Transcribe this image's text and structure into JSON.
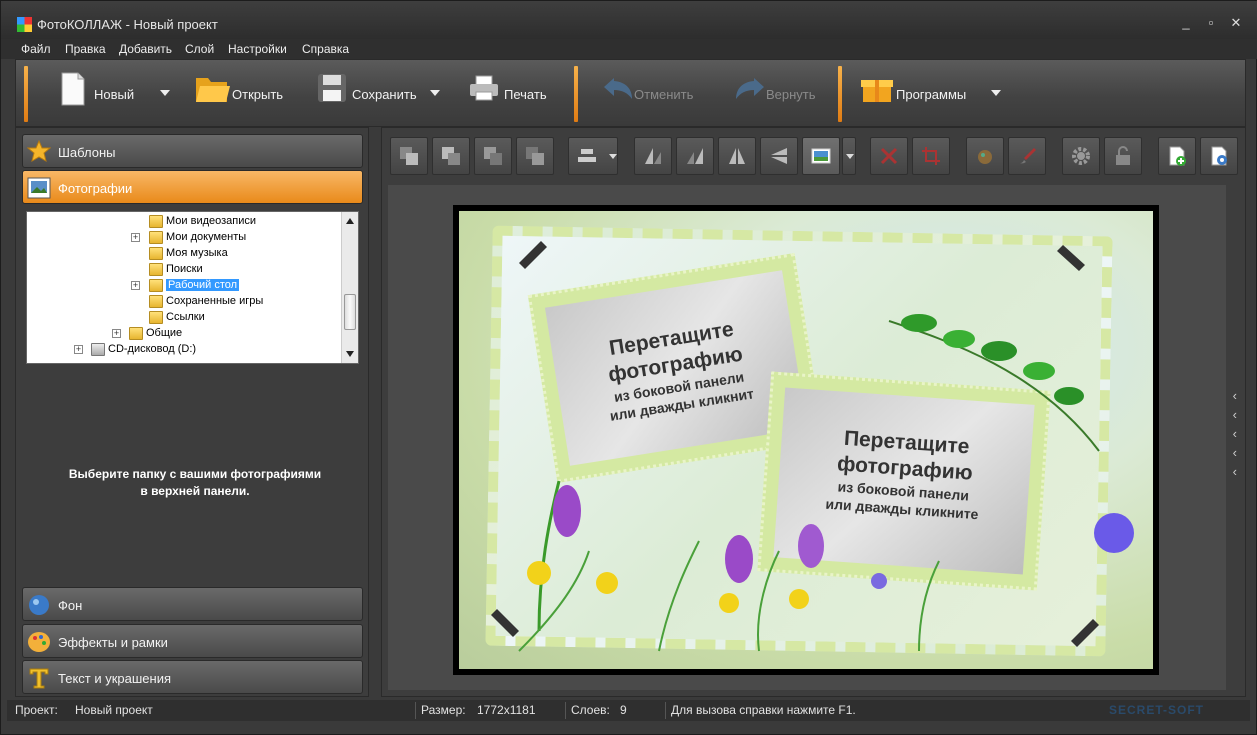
{
  "window": {
    "title": "ФотоКОЛЛАЖ - Новый проект",
    "min": "_",
    "max": "▫",
    "close": "✕"
  },
  "menu": [
    "Файл",
    "Правка",
    "Добавить",
    "Слой",
    "Настройки",
    "Справка"
  ],
  "toolbar": {
    "new": "Новый",
    "open": "Открыть",
    "save": "Сохранить",
    "print": "Печать",
    "undo": "Отменить",
    "redo": "Вернуть",
    "programs": "Программы"
  },
  "left": {
    "templates": "Шаблоны",
    "photos": "Фотографии",
    "tree": [
      {
        "label": "Мои видеозаписи",
        "plus": false
      },
      {
        "label": "Мои документы",
        "plus": true
      },
      {
        "label": "Моя музыка",
        "plus": false
      },
      {
        "label": "Поиски",
        "plus": false
      },
      {
        "label": "Рабочий стол",
        "plus": true,
        "selected": true
      },
      {
        "label": "Сохраненные игры",
        "plus": false
      },
      {
        "label": "Ссылки",
        "plus": false
      },
      {
        "label": "Общие",
        "plus": true
      },
      {
        "label": "CD-дисковод (D:)",
        "plus": true
      }
    ],
    "hint_line1": "Выберите папку с вашими фотографиями",
    "hint_line2": "в верхней панели.",
    "background": "Фон",
    "effects": "Эффекты и рамки",
    "text": "Текст и украшения"
  },
  "canvas": {
    "frame1": {
      "big1": "Перетащите",
      "big2": "фотографию",
      "small1": "из боковой панели",
      "small2": "или дважды кликнит"
    },
    "frame2": {
      "big1": "Перетащите",
      "big2": "фотографию",
      "small1": "из боковой панели",
      "small2": "или дважды кликните"
    },
    "side_arrows": "‹\n‹\n‹\n‹\n‹"
  },
  "status": {
    "project_label": "Проект:",
    "project_value": "Новый проект",
    "size_label": "Размер:",
    "size_value": "1772x1181",
    "layers_label": "Слоев:",
    "layers_value": "9",
    "help": "Для вызова справки нажмите F1.",
    "brand": "SECRET-SOFT"
  },
  "colors": {
    "accent": "#f0962a",
    "selection": "#3399ff"
  }
}
